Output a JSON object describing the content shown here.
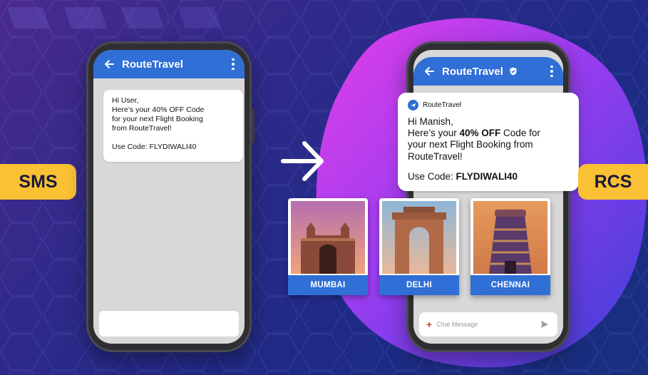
{
  "colors": {
    "accent_blue": "#2f6fd6",
    "tag_yellow": "#f9c133",
    "blob_pink": "#d63fe0",
    "bg_purple": "#3a2a88"
  },
  "labels": {
    "sms": "SMS",
    "rcs": "RCS"
  },
  "sms_phone": {
    "app_title": "RouteTravel",
    "message_lines": [
      "Hi User,",
      "Here’s your 40% OFF Code",
      "for your next Flight Booking",
      "from RouteTravel!"
    ],
    "code_line": "Use Code: FLYDIWALI40"
  },
  "rcs_phone": {
    "app_title": "RouteTravel",
    "brand_name": "RouteTravel",
    "greeting": "Hi Manish,",
    "line2_prefix": "Here’s your ",
    "line2_bold": "40% OFF",
    "line2_suffix": " Code for",
    "line3": "your next Flight Booking from",
    "line4": "RouteTravel!",
    "code_prefix": "Use Code: ",
    "code_value": "FLYDIWALI40",
    "cities": [
      "MUMBAI",
      "DELHI",
      "CHENNAI"
    ],
    "input_placeholder": "Chat Message"
  }
}
